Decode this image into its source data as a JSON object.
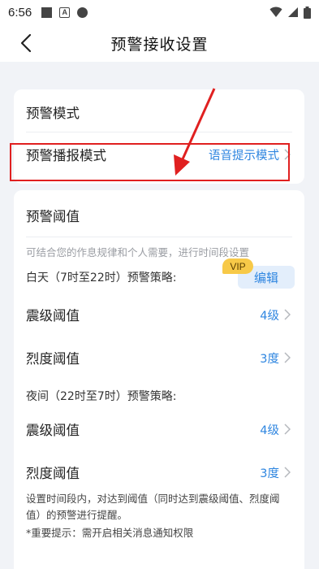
{
  "status_bar": {
    "time": "6:56",
    "icons": [
      "notification-square-icon",
      "a-letter-icon",
      "dot-icon",
      "wifi-icon",
      "signal-icon",
      "battery-icon"
    ]
  },
  "header": {
    "back_icon": "chevron-left-icon",
    "title": "预警接收设置"
  },
  "warning_mode": {
    "section_title": "预警模式",
    "row_label": "预警播报模式",
    "row_value": "语音提示模式"
  },
  "threshold": {
    "section_title": "预警阈值",
    "hint": "可结合您的作息规律和个人需要，进行时间段设置",
    "day_strategy": "白天（7时至22时）预警策略:",
    "vip_badge": "VIP",
    "edit_button": "编辑",
    "day_rows": [
      {
        "label": "震级阈值",
        "value": "4级"
      },
      {
        "label": "烈度阈值",
        "value": "3度"
      }
    ],
    "night_strategy": "夜间（22时至7时）预警策略:",
    "night_rows": [
      {
        "label": "震级阈值",
        "value": "4级"
      },
      {
        "label": "烈度阈值",
        "value": "3度"
      }
    ],
    "footnote_1": "设置时间段内，对达到阈值（同时达到震级阈值、烈度阈值）的预警进行提醒。",
    "footnote_2": "*重要提示：需开启相关消息通知权限"
  },
  "colors": {
    "accent": "#2f86e0",
    "annotation": "#e02020",
    "vip": "#f7c948",
    "background": "#f1f3f7"
  }
}
